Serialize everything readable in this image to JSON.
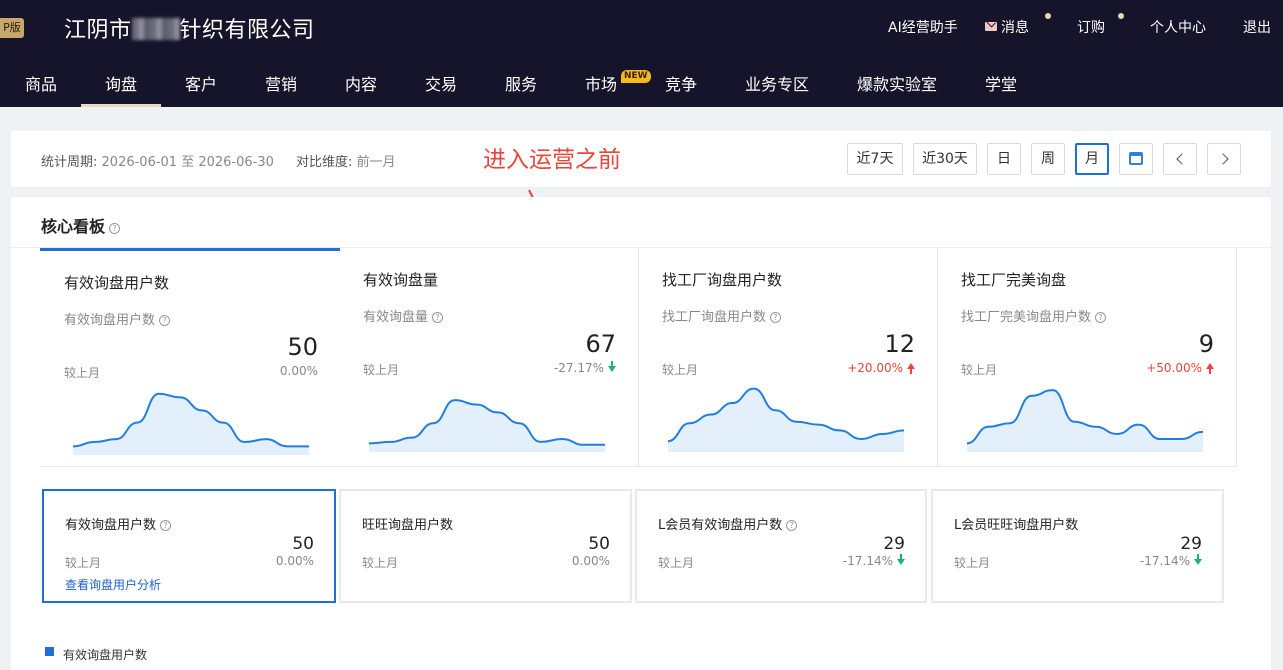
{
  "header": {
    "badge": "P版",
    "company_prefix": "江阴市",
    "company_suffix": "针织有限公司",
    "links": {
      "ai_assistant": "AI经营助手",
      "messages": "消息",
      "subscribe": "订购",
      "personal_center": "个人中心",
      "logout": "退出"
    }
  },
  "nav": {
    "items": [
      "商品",
      "询盘",
      "客户",
      "营销",
      "内容",
      "交易",
      "服务",
      "市场",
      "竞争",
      "业务专区",
      "爆款实验室",
      "学堂"
    ],
    "active": "询盘",
    "new_badge": "NEW"
  },
  "filter": {
    "period_label": "统计周期:",
    "period_value": "2026-06-01 至 2026-06-30",
    "compare_label": "对比维度:",
    "compare_value": "前一月",
    "annotation": "进入运营之前",
    "buttons": [
      "近7天",
      "近30天",
      "日",
      "周",
      "月"
    ],
    "active_button": "月",
    "icons": [
      "calendar-icon",
      "chevron-left-icon",
      "chevron-right-icon"
    ],
    "accent": "#1f6fd6"
  },
  "board": {
    "title": "核心看板",
    "cards": [
      {
        "title": "有效询盘用户数",
        "sub": "有效询盘用户数",
        "value": "50",
        "compare": "较上月",
        "change": "0.00%",
        "trend": "flat",
        "spark": [
          0.12,
          0.18,
          0.22,
          0.45,
          0.85,
          0.8,
          0.62,
          0.45,
          0.18,
          0.22,
          0.12,
          0.12
        ]
      },
      {
        "title": "有效询盘量",
        "sub": "有效询盘量",
        "value": "67",
        "compare": "较上月",
        "change": "-27.17%",
        "trend": "down",
        "spark": [
          0.12,
          0.14,
          0.2,
          0.4,
          0.72,
          0.66,
          0.55,
          0.4,
          0.14,
          0.18,
          0.1,
          0.1
        ]
      },
      {
        "title": "找工厂询盘用户数",
        "sub": "找工厂询盘用户数",
        "value": "12",
        "compare": "较上月",
        "change": "+20.00%",
        "trend": "up",
        "spark": [
          0.15,
          0.4,
          0.52,
          0.68,
          0.88,
          0.58,
          0.42,
          0.38,
          0.3,
          0.18,
          0.25,
          0.3
        ]
      },
      {
        "title": "找工厂完美询盘",
        "sub": "找工厂完美询盘用户数",
        "value": "9",
        "compare": "较上月",
        "change": "+50.00%",
        "trend": "up",
        "spark": [
          0.12,
          0.35,
          0.4,
          0.78,
          0.86,
          0.42,
          0.35,
          0.25,
          0.38,
          0.18,
          0.18,
          0.28
        ]
      }
    ],
    "small_cards": [
      {
        "title": "有效询盘用户数",
        "value": "50",
        "compare": "较上月",
        "change": "0.00%",
        "trend": "flat",
        "link": "查看询盘用户分析",
        "help": true
      },
      {
        "title": "旺旺询盘用户数",
        "value": "50",
        "compare": "较上月",
        "change": "0.00%",
        "trend": "flat",
        "help": false
      },
      {
        "title": "L会员有效询盘用户数",
        "value": "29",
        "compare": "较上月",
        "change": "-17.14%",
        "trend": "down",
        "help": true
      },
      {
        "title": "L会员旺旺询盘用户数",
        "value": "29",
        "compare": "较上月",
        "change": "-17.14%",
        "trend": "down",
        "help": false
      }
    ],
    "legend": "有效询盘用户数",
    "colors": {
      "line": "#1f7fe0",
      "fill": "#e3effb",
      "down": "#1fae7f",
      "up": "#e8463c"
    }
  }
}
